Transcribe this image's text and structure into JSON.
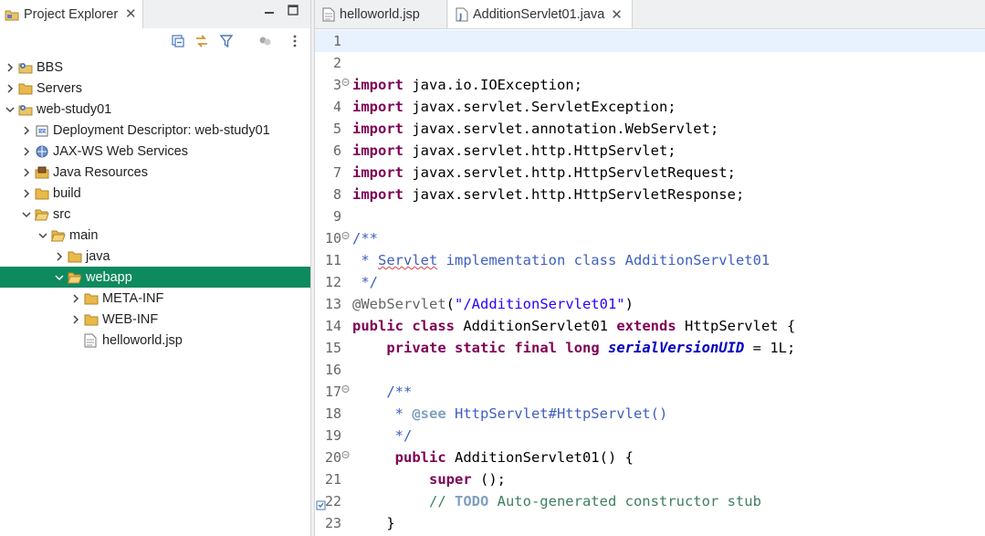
{
  "explorer": {
    "tab_title": "Project Explorer",
    "close_glyph": "✕",
    "minimize_glyph": "▭",
    "maximize_glyph": "▢",
    "toolbar_icons": [
      "collapse-all-icon",
      "link-with-editor-icon",
      "filter-icon",
      "focus-icon",
      "view-menu-icon"
    ],
    "tree": [
      {
        "label": "BBS",
        "depth": 0,
        "expanded": false,
        "icon": "project-icon"
      },
      {
        "label": "Servers",
        "depth": 0,
        "expanded": false,
        "icon": "folder-icon"
      },
      {
        "label": "web-study01",
        "depth": 0,
        "expanded": true,
        "icon": "project-icon"
      },
      {
        "label": "Deployment Descriptor: web-study01",
        "depth": 1,
        "expanded": false,
        "icon": "deployment-descriptor-icon"
      },
      {
        "label": "JAX-WS Web Services",
        "depth": 1,
        "expanded": false,
        "icon": "web-services-icon"
      },
      {
        "label": "Java Resources",
        "depth": 1,
        "expanded": false,
        "icon": "java-resources-icon"
      },
      {
        "label": "build",
        "depth": 1,
        "expanded": false,
        "icon": "folder-icon"
      },
      {
        "label": "src",
        "depth": 1,
        "expanded": true,
        "icon": "folder-open-icon"
      },
      {
        "label": "main",
        "depth": 2,
        "expanded": true,
        "icon": "folder-open-icon"
      },
      {
        "label": "java",
        "depth": 3,
        "expanded": false,
        "icon": "folder-icon"
      },
      {
        "label": "webapp",
        "depth": 3,
        "expanded": true,
        "icon": "folder-open-icon",
        "selected": true
      },
      {
        "label": "META-INF",
        "depth": 4,
        "expanded": false,
        "icon": "folder-icon"
      },
      {
        "label": "WEB-INF",
        "depth": 4,
        "expanded": false,
        "icon": "folder-icon"
      },
      {
        "label": "helloworld.jsp",
        "depth": 4,
        "leaf": true,
        "icon": "jsp-file-icon"
      }
    ]
  },
  "editor": {
    "tabs": [
      {
        "label": "helloworld.jsp",
        "active": false,
        "icon": "jsp-file-icon"
      },
      {
        "label": "AdditionServlet01.java",
        "active": true,
        "icon": "java-file-icon"
      }
    ],
    "close_glyph": "✕",
    "lines": [
      {
        "n": "1",
        "current": true,
        "tokens": []
      },
      {
        "n": "2",
        "tokens": []
      },
      {
        "n": "3",
        "fold": true,
        "tokens": [
          [
            "kw",
            "import"
          ],
          [
            "",
            "java.io.IOException;"
          ]
        ]
      },
      {
        "n": "4",
        "tokens": [
          [
            "kw",
            "import"
          ],
          [
            "",
            "javax.servlet.ServletException;"
          ]
        ]
      },
      {
        "n": "5",
        "tokens": [
          [
            "kw",
            "import"
          ],
          [
            "",
            "javax.servlet.annotation.WebServlet;"
          ]
        ]
      },
      {
        "n": "6",
        "tokens": [
          [
            "kw",
            "import"
          ],
          [
            "",
            "javax.servlet.http.HttpServlet;"
          ]
        ]
      },
      {
        "n": "7",
        "tokens": [
          [
            "kw",
            "import"
          ],
          [
            "",
            "javax.servlet.http.HttpServletRequest;"
          ]
        ]
      },
      {
        "n": "8",
        "tokens": [
          [
            "kw",
            "import"
          ],
          [
            "",
            "javax.servlet.http.HttpServletResponse;"
          ]
        ]
      },
      {
        "n": "9",
        "tokens": []
      },
      {
        "n": "10",
        "fold": true,
        "tokens": [
          [
            "cm",
            "/**"
          ]
        ]
      },
      {
        "n": "11",
        "tokens": [
          [
            "cm",
            " * "
          ],
          [
            "cm squig",
            "Servlet"
          ],
          [
            "cm",
            " implementation class AdditionServlet01"
          ]
        ]
      },
      {
        "n": "12",
        "tokens": [
          [
            "cm",
            " */"
          ]
        ]
      },
      {
        "n": "13",
        "tokens": [
          [
            "ann",
            "@WebServlet"
          ],
          [
            "",
            "("
          ],
          [
            "str",
            "\"/AdditionServlet01\""
          ],
          [
            "",
            ")"
          ]
        ]
      },
      {
        "n": "14",
        "tokens": [
          [
            "kw",
            "public"
          ],
          [
            "",
            " "
          ],
          [
            "kw",
            "class"
          ],
          [
            "",
            " AdditionServlet01 "
          ],
          [
            "kw",
            "extends"
          ],
          [
            "",
            " HttpServlet {"
          ]
        ]
      },
      {
        "n": "15",
        "tokens": [
          [
            "",
            "    "
          ],
          [
            "kw",
            "private"
          ],
          [
            "",
            " "
          ],
          [
            "kw",
            "static"
          ],
          [
            "",
            " "
          ],
          [
            "kw",
            "final"
          ],
          [
            "",
            " "
          ],
          [
            "kw",
            "long"
          ],
          [
            "",
            " "
          ],
          [
            "fld",
            "serialVersionUID"
          ],
          [
            "",
            " = 1L;"
          ]
        ]
      },
      {
        "n": "16",
        "tokens": []
      },
      {
        "n": "17",
        "fold": true,
        "tokens": [
          [
            "cm",
            "    /**"
          ]
        ]
      },
      {
        "n": "18",
        "tokens": [
          [
            "cm",
            "     * "
          ],
          [
            "cmtag",
            "@see"
          ],
          [
            "cm",
            " HttpServlet#HttpServlet()"
          ]
        ]
      },
      {
        "n": "19",
        "tokens": [
          [
            "cm",
            "     */"
          ]
        ]
      },
      {
        "n": "20",
        "fold": true,
        "tokens": [
          [
            "",
            "     "
          ],
          [
            "kw",
            "public"
          ],
          [
            "",
            " AdditionServlet01() {"
          ]
        ]
      },
      {
        "n": "21",
        "tokens": [
          [
            "",
            "         "
          ],
          [
            "kw",
            "super"
          ],
          [
            "",
            "();"
          ]
        ]
      },
      {
        "n": "22",
        "task": true,
        "tokens": [
          [
            "lc",
            "         // "
          ],
          [
            "todo",
            "TODO"
          ],
          [
            "lc",
            " Auto-generated constructor stub"
          ]
        ]
      },
      {
        "n": "23",
        "tokens": [
          [
            "",
            "    }"
          ]
        ]
      }
    ]
  },
  "colors": {
    "selection": "#0e8a5f",
    "keyword": "#7f0055",
    "javadoc": "#3f5fbf",
    "string": "#2a00ff",
    "line_comment": "#3f7f5f",
    "field": "#0000c0",
    "current_line": "#e8f2fe"
  }
}
